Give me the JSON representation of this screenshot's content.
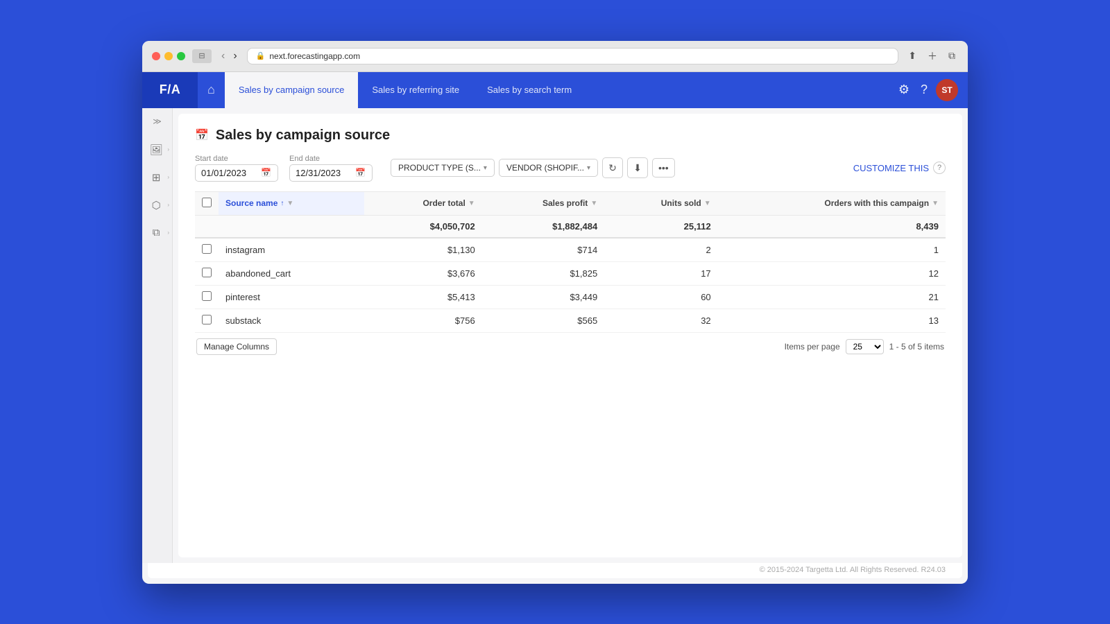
{
  "browser": {
    "url": "next.forecastingapp.com",
    "reload_title": "Reload"
  },
  "app": {
    "logo": "F/A",
    "nav_tabs": [
      {
        "id": "campaign",
        "label": "Sales by campaign source",
        "active": true
      },
      {
        "id": "referring",
        "label": "Sales by referring site",
        "active": false
      },
      {
        "id": "search",
        "label": "Sales by search term",
        "active": false
      }
    ],
    "avatar_initials": "ST"
  },
  "page": {
    "title": "Sales by campaign source",
    "start_date_label": "Start date",
    "start_date": "01/01/2023",
    "end_date_label": "End date",
    "end_date": "12/31/2023",
    "filters": [
      {
        "id": "product_type",
        "label": "PRODUCT TYPE (S..."
      },
      {
        "id": "vendor",
        "label": "VENDOR (SHOPIF..."
      }
    ],
    "customize_label": "CUSTOMIZE THIS",
    "table": {
      "columns": [
        {
          "id": "source_name",
          "label": "Source name",
          "active_sort": true,
          "numeric": false
        },
        {
          "id": "order_total",
          "label": "Order total",
          "active_sort": false,
          "numeric": true
        },
        {
          "id": "sales_profit",
          "label": "Sales profit",
          "active_sort": false,
          "numeric": true
        },
        {
          "id": "units_sold",
          "label": "Units sold",
          "active_sort": false,
          "numeric": true
        },
        {
          "id": "orders_with_campaign",
          "label": "Orders with this campaign",
          "active_sort": false,
          "numeric": true
        }
      ],
      "summary_row": {
        "source_name": "",
        "order_total": "$4,050,702",
        "sales_profit": "$1,882,484",
        "units_sold": "25,112",
        "orders_with_campaign": "8,439"
      },
      "rows": [
        {
          "source_name": "instagram",
          "order_total": "$1,130",
          "sales_profit": "$714",
          "units_sold": "2",
          "orders_with_campaign": "1"
        },
        {
          "source_name": "abandoned_cart",
          "order_total": "$3,676",
          "sales_profit": "$1,825",
          "units_sold": "17",
          "orders_with_campaign": "12"
        },
        {
          "source_name": "pinterest",
          "order_total": "$5,413",
          "sales_profit": "$3,449",
          "units_sold": "60",
          "orders_with_campaign": "21"
        },
        {
          "source_name": "substack",
          "order_total": "$756",
          "sales_profit": "$565",
          "units_sold": "32",
          "orders_with_campaign": "13"
        }
      ]
    },
    "manage_columns_label": "Manage Columns",
    "items_per_page_label": "Items per page",
    "items_per_page": "25",
    "page_range": "1 - 5 of 5 items"
  },
  "footer": {
    "text": "© 2015-2024 Targetta Ltd. All Rights Reserved. R24.03"
  },
  "sidebar": {
    "expand_icon": "≫",
    "items": [
      {
        "id": "photos",
        "icon": "🖼"
      },
      {
        "id": "layers",
        "icon": "⊞"
      },
      {
        "id": "box",
        "icon": "⬡"
      },
      {
        "id": "copy",
        "icon": "⧉"
      }
    ]
  }
}
